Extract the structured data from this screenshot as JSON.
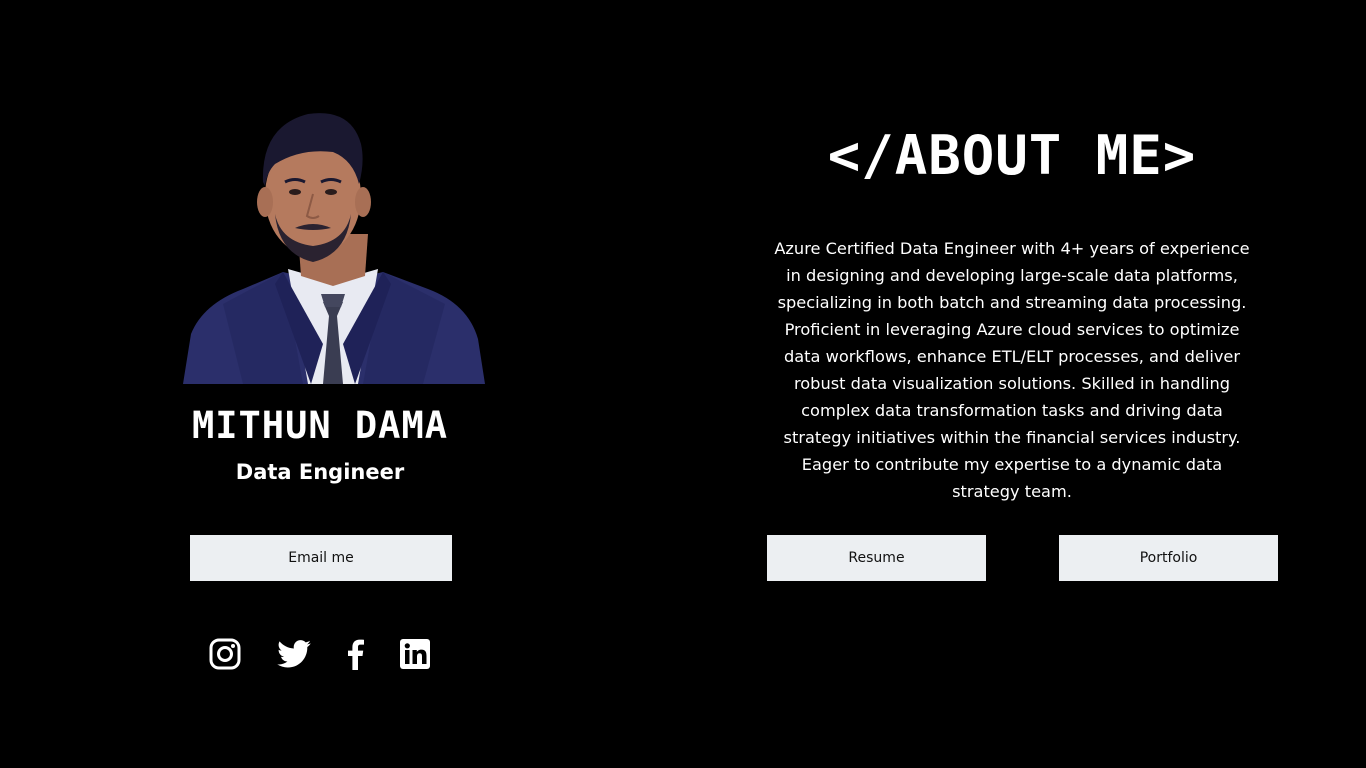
{
  "profile": {
    "name": "MITHUN DAMA",
    "role": "Data Engineer",
    "photo_icon": "person-portrait-photo"
  },
  "buttons": {
    "email": "Email me",
    "resume": "Resume",
    "portfolio": "Portfolio"
  },
  "social": [
    {
      "icon": "instagram-icon"
    },
    {
      "icon": "twitter-icon"
    },
    {
      "icon": "facebook-icon"
    },
    {
      "icon": "linkedin-icon"
    }
  ],
  "about": {
    "title": "</ABOUT ME>",
    "lines": [
      "Azure Certified Data Engineer with 4+ years of experience",
      "in designing and developing large-scale data platforms,",
      "specializing in both batch and streaming data processing.",
      "Proficient in leveraging Azure cloud services to optimize",
      "data workflows, enhance ETL/ELT processes, and deliver",
      "robust data visualization solutions. Skilled in handling",
      "complex data transformation tasks and driving data",
      "strategy initiatives within the financial services industry.",
      "Eager to contribute my expertise to a dynamic data",
      "strategy team."
    ]
  },
  "colors": {
    "background": "#000000",
    "text": "#ffffff",
    "button_bg": "#eceff2",
    "button_text": "#111111",
    "suit": "#2b2f6b"
  }
}
